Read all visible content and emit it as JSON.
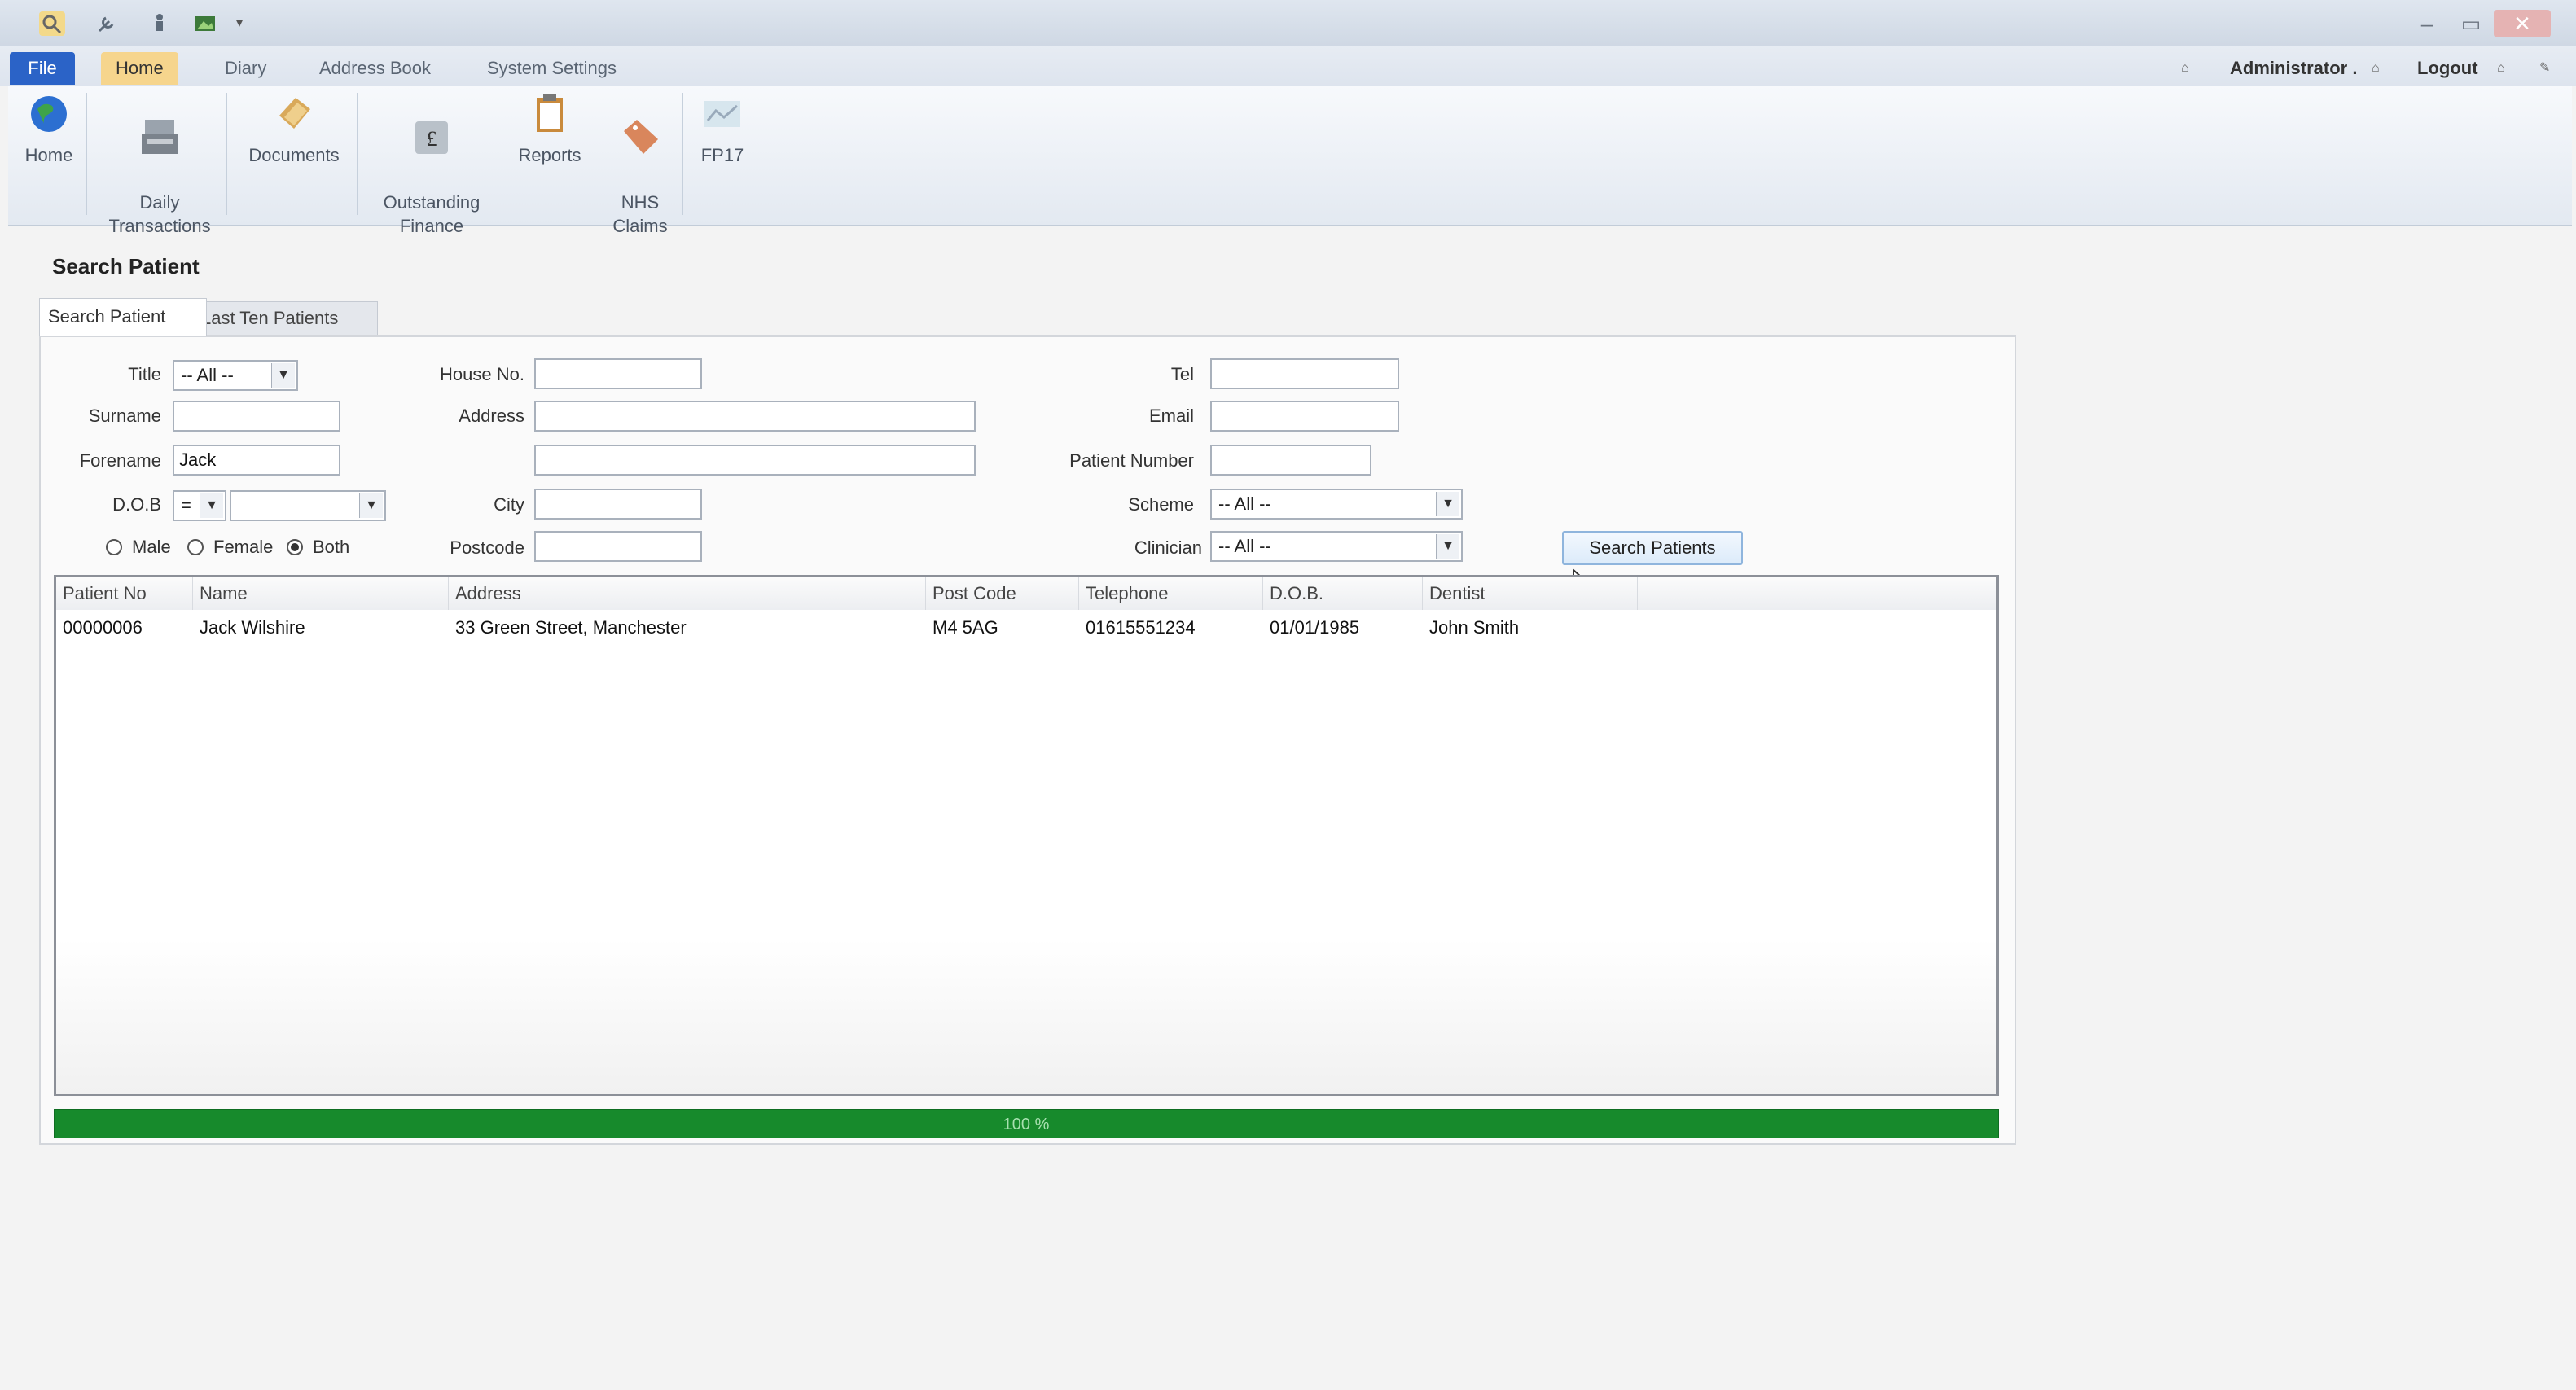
{
  "title_bar": {
    "window_controls": [
      "–",
      "▭",
      "✕"
    ]
  },
  "tabs": {
    "file": "File",
    "home": "Home",
    "diary": "Diary",
    "address_book": "Address Book",
    "system_settings": "System Settings"
  },
  "user_menu": {
    "user": "Administrator .",
    "logout": "Logout"
  },
  "ribbon": {
    "buttons": [
      {
        "label": "Home",
        "icon": "globe-icon"
      },
      {
        "label": "Daily\nTransactions",
        "icon": "cash-register-icon"
      },
      {
        "label": "Documents",
        "icon": "documents-icon"
      },
      {
        "label": "Outstanding\nFinance",
        "icon": "pound-icon"
      },
      {
        "label": "Reports",
        "icon": "clipboard-icon"
      },
      {
        "label": "NHS\nClaims",
        "icon": "tag-icon"
      },
      {
        "label": "FP17",
        "icon": "form-icon"
      }
    ]
  },
  "page": {
    "title": "Search Patient",
    "tab_search": "Search Patient",
    "tab_last": "Last Ten Patients"
  },
  "form": {
    "title_label": "Title",
    "title_value": "-- All --",
    "surname_label": "Surname",
    "surname_value": "",
    "forename_label": "Forename",
    "forename_value": "Jack",
    "dob_label": "D.O.B",
    "dob_op": "=",
    "dob_value": "",
    "gender": {
      "male": "Male",
      "female": "Female",
      "both": "Both",
      "selected": "both"
    },
    "house_label": "House No.",
    "address_label": "Address",
    "city_label": "City",
    "postcode_label": "Postcode",
    "tel_label": "Tel",
    "email_label": "Email",
    "patient_number_label": "Patient Number",
    "scheme_label": "Scheme",
    "scheme_value": "-- All --",
    "clinician_label": "Clinician",
    "clinician_value": "-- All --",
    "search_button": "Search Patients"
  },
  "grid": {
    "columns": [
      "Patient No",
      "Name",
      "Address",
      "Post Code",
      "Telephone",
      "D.O.B.",
      "Dentist"
    ],
    "rows": [
      [
        "00000006",
        "Jack Wilshire",
        "33 Green Street, Manchester",
        "M4 5AG",
        "01615551234",
        "01/01/1985",
        "John Smith"
      ]
    ]
  },
  "progress": {
    "label": "100 %",
    "value": 1.0,
    "color": "#178a2c"
  }
}
